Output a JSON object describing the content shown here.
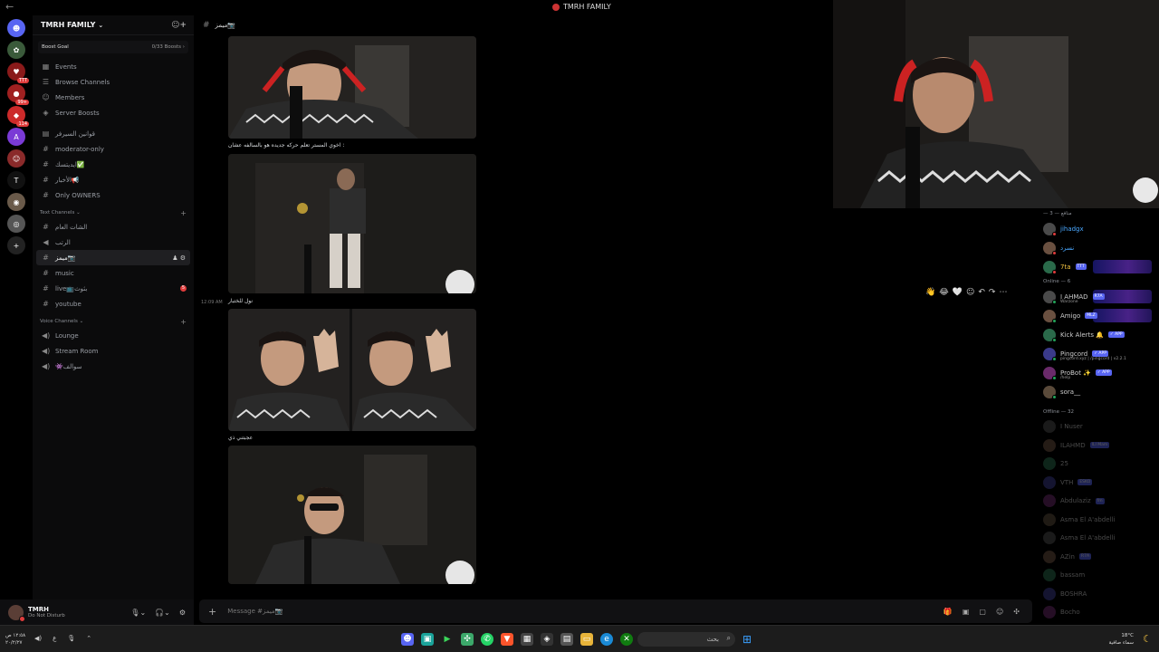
{
  "window": {
    "title": "TMRH FAMILY",
    "back_glyph": "←"
  },
  "servers": [
    {
      "label": "",
      "color": "#5865f2",
      "glyph": "☻"
    },
    {
      "label": "",
      "color": "#3a5a3a",
      "glyph": "✿"
    },
    {
      "label": "",
      "color": "#8a1a1a",
      "glyph": "♥",
      "badge": "TTT"
    },
    {
      "label": "",
      "color": "#a02020",
      "glyph": "●",
      "badge": "99+"
    },
    {
      "label": "",
      "color": "#cc2a2a",
      "glyph": "◆",
      "badge": "114"
    },
    {
      "label": "",
      "color": "#7a3ad6",
      "glyph": "A"
    },
    {
      "label": "",
      "color": "#8a2a2a",
      "glyph": "☺"
    },
    {
      "label": "T",
      "color": "#111",
      "glyph": "T"
    },
    {
      "label": "",
      "color": "#6a5a4a",
      "glyph": "◉"
    },
    {
      "label": "",
      "color": "#555",
      "glyph": "◎"
    },
    {
      "label": "",
      "color": "#222",
      "glyph": "+"
    },
    {
      "label": "",
      "color": "#222",
      "glyph": "⊙"
    }
  ],
  "server": {
    "name": "TMRH FAMILY",
    "boost_goal": "Boost Goal",
    "boost_count": "0/33 Boosts ›"
  },
  "nav": [
    {
      "label": "Events",
      "icon": "▦"
    },
    {
      "label": "Browse Channels",
      "icon": "☰"
    },
    {
      "label": "Members",
      "icon": "☺"
    },
    {
      "label": "Server Boosts",
      "icon": "◈"
    }
  ],
  "top_channels": [
    {
      "label": "قوانين السيرفر",
      "icon": "▤"
    },
    {
      "label": "moderator-only",
      "icon": "#"
    },
    {
      "label": "ايديتسك✅",
      "icon": "#"
    },
    {
      "label": "الأخبار📢",
      "icon": "#"
    },
    {
      "label": "Only OWNERS",
      "icon": "#"
    }
  ],
  "text_category": "Text Channels ⌄",
  "text_channels": [
    {
      "label": "الشات العام",
      "icon": "#"
    },
    {
      "label": "الرتب",
      "icon": "◀"
    },
    {
      "label": "ميمز📷",
      "icon": "#",
      "active": true,
      "tail": "♟ ⚙"
    },
    {
      "label": "music",
      "icon": "#"
    },
    {
      "label": "live📺بثوث",
      "icon": "#",
      "unread": "5"
    },
    {
      "label": "youtube",
      "icon": "#"
    }
  ],
  "voice_category": "Voice Channels ⌄",
  "voice_channels": [
    {
      "label": "Lounge",
      "icon": "◀)"
    },
    {
      "label": "Stream Room",
      "icon": "◀)"
    },
    {
      "label": "👾سوالف",
      "icon": "◀)"
    }
  ],
  "user": {
    "name": "TMRH",
    "status": "Do Not Disturb"
  },
  "channel": {
    "name": "ميمز📷",
    "placeholder": "Message #ميمز📷"
  },
  "messages": [
    {
      "caption": "اخوي المستر تعلم حركه جديده هو بالسالفه عشان :",
      "timestamp": ""
    },
    {
      "caption": "نول للختبار",
      "timestamp": "12:09 AM"
    },
    {
      "caption": "عجبتني ذي",
      "timestamp": ""
    }
  ],
  "reactions": [
    "👋",
    "😂",
    "🤍",
    "☺",
    "↶",
    "↷",
    "⋯"
  ],
  "member_groups": {
    "top_header": "— منافع — 3",
    "online_header": "Online — 6",
    "offline_header": "Offline — 32"
  },
  "top_members": [
    {
      "name": "jihadgx",
      "color": "#4aa8ff"
    },
    {
      "name": "نسرد",
      "color": "#4aa8ff"
    },
    {
      "name": "7ta",
      "color": "#f5c542",
      "tag": "TTT",
      "banner": true
    }
  ],
  "online_members": [
    {
      "name": "I AHMAD",
      "tag": "R7A",
      "sub": "Warzone",
      "banner": true
    },
    {
      "name": "Amigo",
      "tag": "MLZ",
      "banner": true
    },
    {
      "name": "Kick Alerts 🔔",
      "tag": "✓ APP"
    },
    {
      "name": "Pingcord",
      "tag": "✓ APP",
      "sub": "pingcord.xyz | /pingcord | v2.2.1"
    },
    {
      "name": "ProBot ✨",
      "tag": "✓ APP",
      "sub": "/help"
    },
    {
      "name": "sora__"
    }
  ],
  "offline_members": [
    {
      "name": "I Nuser"
    },
    {
      "name": "ILAHMD",
      "tag": "ILI Mam"
    },
    {
      "name": "25"
    },
    {
      "name": "VTH",
      "tag": "ESKO"
    },
    {
      "name": "Abdulaziz",
      "tag": "fm"
    },
    {
      "name": "Asma El A'abdelli"
    },
    {
      "name": "Asma El A'abdelli"
    },
    {
      "name": "AZin",
      "tag": "R7A"
    },
    {
      "name": "bassam"
    },
    {
      "name": "BOSHRA"
    },
    {
      "name": "Bocho"
    }
  ],
  "taskbar": {
    "time": "١٢:٥٨ ص",
    "date": "٢٠/٢/٢٧",
    "search_label": "بحث",
    "temp": "18°C",
    "weather": "سماء صافية",
    "lang": "ع"
  },
  "colors": {
    "accent": "#5865f2",
    "dnd": "#e03c3c",
    "online": "#23a55a"
  }
}
